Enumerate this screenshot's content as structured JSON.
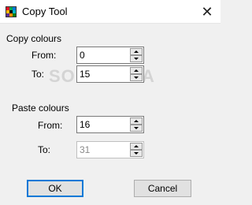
{
  "window": {
    "title": "Copy Tool",
    "close_glyph": "✕"
  },
  "copy": {
    "heading": "Copy colours",
    "from_label": "From:",
    "from_value": "0",
    "to_label": "To:",
    "to_value": "15"
  },
  "paste": {
    "heading": "Paste colours",
    "from_label": "From:",
    "from_value": "16",
    "to_label": "To:",
    "to_value": "31"
  },
  "buttons": {
    "ok": "OK",
    "cancel": "Cancel"
  },
  "watermark": "SOFTPEDIA",
  "icon": {
    "name": "palette-icon",
    "colors": [
      "#e81123",
      "#00a651",
      "#0078d7",
      "#ffb900",
      "#000000",
      "#00b7c3",
      "#5c2d91",
      "#ff8c00",
      "#107c10"
    ]
  }
}
